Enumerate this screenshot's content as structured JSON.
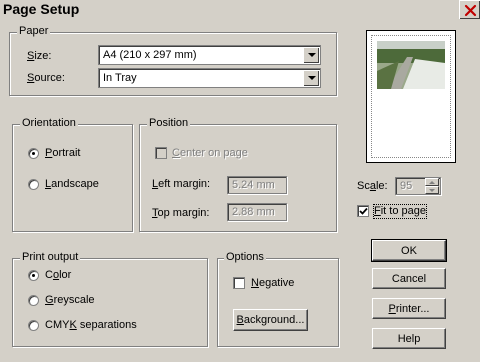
{
  "window": {
    "title": "Page Setup"
  },
  "paper": {
    "legend": "Paper",
    "size_label": "Size:",
    "size_value": "A4 (210 x 297 mm)",
    "source_label": "Source:",
    "source_value": "In Tray"
  },
  "orientation": {
    "legend": "Orientation",
    "options": [
      {
        "label": "Portrait",
        "checked": true
      },
      {
        "label": "Landscape",
        "checked": false
      }
    ]
  },
  "position": {
    "legend": "Position",
    "center_label": "Center on page",
    "left_margin_label": "Left margin:",
    "left_margin_value": "5.24 mm",
    "top_margin_label": "Top margin:",
    "top_margin_value": "2.88 mm"
  },
  "scale": {
    "label": "Scale:",
    "value": "95",
    "fit_label": "Fit to page",
    "fit_checked": true
  },
  "print_output": {
    "legend": "Print output",
    "options": [
      {
        "label": "Color",
        "checked": true
      },
      {
        "label": "Greyscale",
        "checked": false
      },
      {
        "label": "CMYK separations",
        "checked": false
      }
    ]
  },
  "options": {
    "legend": "Options",
    "negative_label": "Negative",
    "negative_checked": false,
    "background_button": "Background..."
  },
  "buttons": {
    "ok": "OK",
    "cancel": "Cancel",
    "printer": "Printer...",
    "help": "Help"
  },
  "colors": {
    "dialog_bg": "#d4d0c8",
    "close_x": "#c00000"
  },
  "icons": {
    "close": "close-icon",
    "dropdown": "chevron-down-icon",
    "check": "check-icon"
  }
}
